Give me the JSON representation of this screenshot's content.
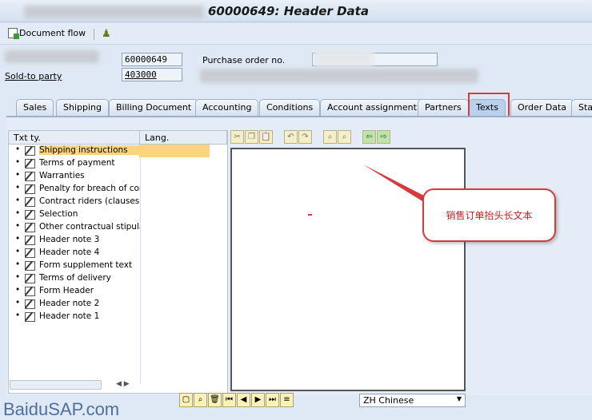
{
  "title": "60000649: Header Data",
  "toolbar": {
    "document_flow": "Document flow"
  },
  "header": {
    "order_number": "60000649",
    "po_label": "Purchase order no.",
    "sold_to_label": "Sold-to party",
    "sold_to_value": "403000"
  },
  "tabs": [
    "Sales",
    "Shipping",
    "Billing Document",
    "Accounting",
    "Conditions",
    "Account assignment",
    "Partners",
    "Texts",
    "Order Data",
    "Stat"
  ],
  "active_tab": "Texts",
  "tree": {
    "col_type": "Txt ty.",
    "col_lang": "Lang.",
    "items": [
      "Shipping instructions",
      "Terms of payment",
      "Warranties",
      "Penalty for breach of cont",
      "Contract riders (clauses)",
      "Selection",
      "Other contractual stipulati",
      "Header note 3",
      "Header note 4",
      "Form supplement text",
      "Terms of delivery",
      "Form Header",
      "Header note 2",
      "Header note 1"
    ]
  },
  "language": "ZH Chinese",
  "callout": "销售订单抬头长文本",
  "watermark": "BaiduSAP.com",
  "colors": {
    "highlight": "#d63a3a",
    "selection": "#fbd47d"
  }
}
